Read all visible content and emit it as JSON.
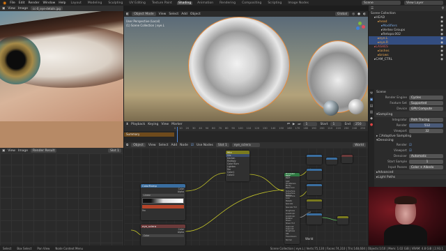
{
  "menu": [
    "File",
    "Edit",
    "Render",
    "Window",
    "Help"
  ],
  "workspaces": [
    "Layout",
    "Modeling",
    "Sculpting",
    "UV Editing",
    "Texture Paint",
    "Shading",
    "Animation",
    "Rendering",
    "Compositing",
    "Scripting",
    "Image Nodes"
  ],
  "active_workspace": "Shading",
  "scene_label": "Scene",
  "view_layer_label": "View Layer",
  "image_editor": {
    "view": "View",
    "image": "Image",
    "file": "cc-0_eye-details.jpg"
  },
  "viewport": {
    "mode": "Object Mode",
    "menus": [
      "View",
      "Select",
      "Add",
      "Object"
    ],
    "transform": "Global",
    "overlay_line1": "User Perspective (Local)",
    "overlay_line2": "(1) Scene Collection | eye.L"
  },
  "timeline": {
    "menus": [
      "Playback",
      "Keying",
      "View",
      "Marker"
    ],
    "frame": "1",
    "start_label": "Start",
    "start": "1",
    "end_label": "End",
    "end": "250",
    "ticks": [
      "0",
      "10",
      "20",
      "30",
      "40",
      "50",
      "60",
      "70",
      "80",
      "90",
      "100",
      "110",
      "120",
      "130",
      "140",
      "150",
      "160",
      "170",
      "180",
      "190",
      "200",
      "210",
      "220",
      "230",
      "240",
      "250"
    ],
    "summary": "Summary"
  },
  "outliner": {
    "title": "Scene Collection",
    "items": [
      {
        "label": "HEAD",
        "color": "#c8c8c8",
        "indent": 1
      },
      {
        "label": "head",
        "color": "#e0a050",
        "indent": 2
      },
      {
        "label": "Modifiers",
        "color": "#7aa8e0",
        "indent": 3
      },
      {
        "label": "Vertex Groups",
        "color": "#c8c8c8",
        "indent": 3
      },
      {
        "label": "Retopo.002",
        "color": "#c8c8c8",
        "indent": 3
      },
      {
        "label": "eye.L",
        "color": "#e0a050",
        "indent": 2
      },
      {
        "label": "eye.R",
        "color": "#e0a050",
        "indent": 2
      },
      {
        "label": "LASHES",
        "color": "#d06060",
        "indent": 1
      },
      {
        "label": "lashes",
        "color": "#e0a050",
        "indent": 2
      },
      {
        "label": "brows",
        "color": "#e0a050",
        "indent": 2
      },
      {
        "label": "CAM_CTRL",
        "color": "#c8c8c8",
        "indent": 1
      }
    ]
  },
  "properties": {
    "scene_label": "Scene",
    "render_engine_label": "Render Engine",
    "render_engine": "Cycles",
    "feature_set_label": "Feature Set",
    "feature_set": "Supported",
    "device_label": "Device",
    "device": "GPU Compute",
    "sampling_header": "Sampling",
    "integrator_label": "Integrator",
    "integrator": "Path Tracing",
    "render_label": "Render",
    "render_samples": "512",
    "viewport_label": "Viewport",
    "viewport_samples": "32",
    "adaptive": "Adaptive Sampling",
    "denoising": "Denoising",
    "denoise_render_label": "Render",
    "denoise_viewport_label": "Viewport",
    "denoiser_label": "Denoiser",
    "denoiser": "Automatic",
    "start_sample_label": "Start Sample",
    "start_sample": "1",
    "input_passes_label": "Input Passes",
    "input_passes": "Color + Albedo",
    "advanced": "Advanced",
    "light_paths": "Light Paths"
  },
  "image_editor2": {
    "view": "View",
    "image": "Image",
    "slot": "Render Result",
    "slot_num": "Slot 1"
  },
  "node_editor": {
    "menus": [
      "Object",
      "View",
      "Select",
      "Add",
      "Node"
    ],
    "use_nodes": "Use Nodes",
    "slot": "Slot 1",
    "material": "eye_sclera",
    "world_material": "World",
    "frame_label": "World"
  },
  "nodes": {
    "mix_title": "Mix",
    "mix_rows": [
      "Fac",
      "Color1",
      "Color2"
    ],
    "mix_options": [
      "Mix",
      "Darken",
      "Multiply",
      "Color Burn",
      "Lighten"
    ],
    "ramp_title": "ColorRamp",
    "ramp_rows": [
      "Color",
      "Alpha",
      "Fac"
    ],
    "ramp_mode": "Linear",
    "image_title": "eye_sclera",
    "image_rows": [
      "Color",
      "Alpha"
    ],
    "image_mode": "Color",
    "bsdf_title": "Principled BSDF",
    "bsdf_rows": [
      "BSDF",
      "GGX",
      "Christensen-Burley",
      "Base Color",
      "Subsurface",
      "Subsurface Radius",
      "Subsurface Color",
      "Metallic",
      "Specular",
      "Specular Tint",
      "Roughness",
      "Anisotropic",
      "Anisotropic Rotation",
      "Sheen",
      "Sheen Tint",
      "Clearcoat",
      "Clearcoat Roughness",
      "IOR",
      "Transmission",
      "Normal"
    ],
    "output_title": "Material Output"
  },
  "statusbar": {
    "select": "Select",
    "box_select": "Box Select",
    "pan_view": "Pan View",
    "context_menu": "Node Context Menu",
    "stats": "Scene Collection | eye.L | Verts:75,130 | Faces:74,310 | Tris:148,604 | Objects:1/10 | Mem: 1.02 GiB | VRAM: 4.8 GiB | 2.93.1"
  },
  "colors": {
    "accent_blue": "#4772b3",
    "selected_row": "#334d80",
    "timeline_playhead": "#4e87d8",
    "summary_orange": "#8a5a1e",
    "node_image_header": "#6c3a3a",
    "node_converter_header": "#3a6ea0",
    "node_shader_header": "#2e7a42",
    "node_color_header": "#7a7a1e"
  }
}
